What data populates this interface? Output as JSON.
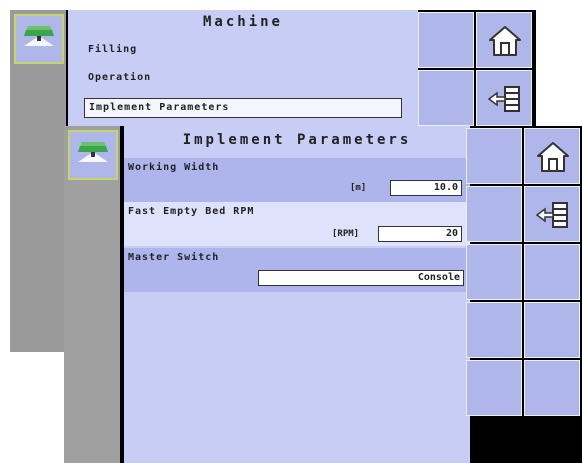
{
  "back_screen": {
    "title": "Machine",
    "menu_items": [
      "Filling",
      "Operation",
      "Implement Parameters"
    ]
  },
  "front_screen": {
    "title": "Implement Parameters",
    "parameters": [
      {
        "label": "Working Width",
        "unit": "[m]",
        "value": "10.0"
      },
      {
        "label": "Fast Empty Bed RPM",
        "unit": "[RPM]",
        "value": "20"
      },
      {
        "label": "Master Switch",
        "unit": "",
        "value": "Console"
      }
    ]
  },
  "icons": {
    "app": "spreader-icon",
    "home": "home-icon",
    "back": "back-arrow-list-icon"
  },
  "colors": {
    "panel": "#c8cdf5",
    "softkey": "#aeb6ea",
    "row_alt": "#aeb4ec",
    "row_plain": "#dfe2fb",
    "left_bar": "#9a9a9a",
    "app_border": "#c4d66a"
  }
}
